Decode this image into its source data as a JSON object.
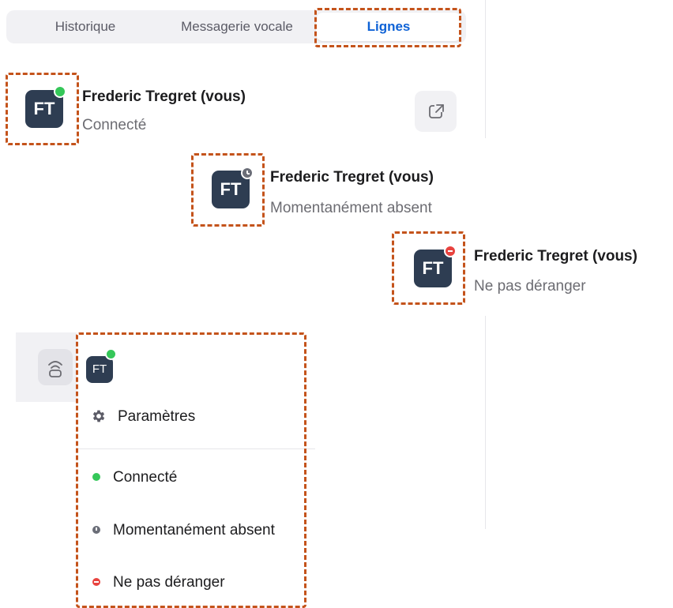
{
  "tabs": [
    {
      "label": "Historique"
    },
    {
      "label": "Messagerie vocale"
    },
    {
      "label": "Lignes",
      "active": true
    }
  ],
  "avatar": {
    "initials": "FT"
  },
  "users": [
    {
      "name": "Frederic Tregret (vous)",
      "status": "Connecté",
      "indicator": "green"
    },
    {
      "name": "Frederic Tregret (vous)",
      "status": "Momentanément absent",
      "indicator": "gray"
    },
    {
      "name": "Frederic Tregret (vous)",
      "status": "Ne pas déranger",
      "indicator": "red"
    }
  ],
  "menu": {
    "settings_label": "Paramètres",
    "options": [
      {
        "label": "Connecté",
        "color": "#35c759"
      },
      {
        "label": "Momentanément absent",
        "color": "#6b6e78"
      },
      {
        "label": "Ne pas déranger",
        "color": "#e8433f"
      }
    ]
  },
  "colors": {
    "accent": "#0e62d6",
    "highlight_border": "#c4531b",
    "avatar_bg": "#2e3d52",
    "online": "#35c759",
    "away": "#6b6e78",
    "dnd": "#e8433f"
  },
  "icons": {
    "external": "external-link-icon",
    "lines": "phone-lines-icon",
    "settings": "gear-icon"
  }
}
